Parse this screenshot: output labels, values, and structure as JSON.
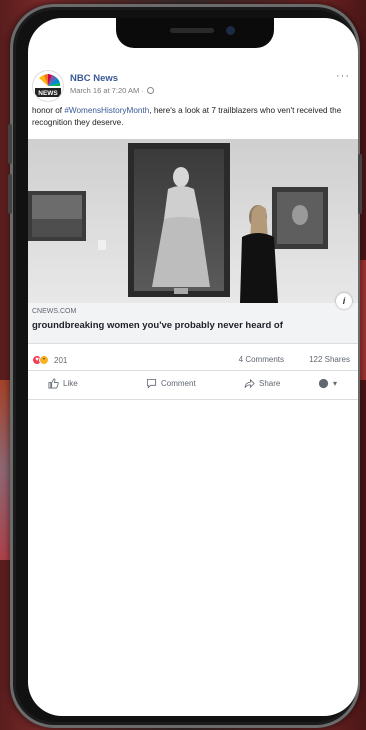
{
  "post": {
    "page_name": "NBC News",
    "avatar_text": "NEWS",
    "timestamp": "March 16 at 7:20 AM ·",
    "more_label": "···",
    "caption_start": "honor of ",
    "hashtag": "#WomensHistoryMonth",
    "caption_end": ", here's a look at 7 trailblazers who ven't received the recognition they deserve.",
    "link_domain": "CNEWS.COM",
    "link_title": "groundbreaking women you've probably never heard of",
    "info_label": "i",
    "reaction_count": "201",
    "comments": "4 Comments",
    "shares": "122 Shares",
    "actions": {
      "like": "Like",
      "comment": "Comment",
      "share": "Share",
      "audience": "▾"
    }
  },
  "colors": {
    "brand_blue": "#3b5998",
    "love": "#f33e58",
    "wow": "#f7b125"
  }
}
